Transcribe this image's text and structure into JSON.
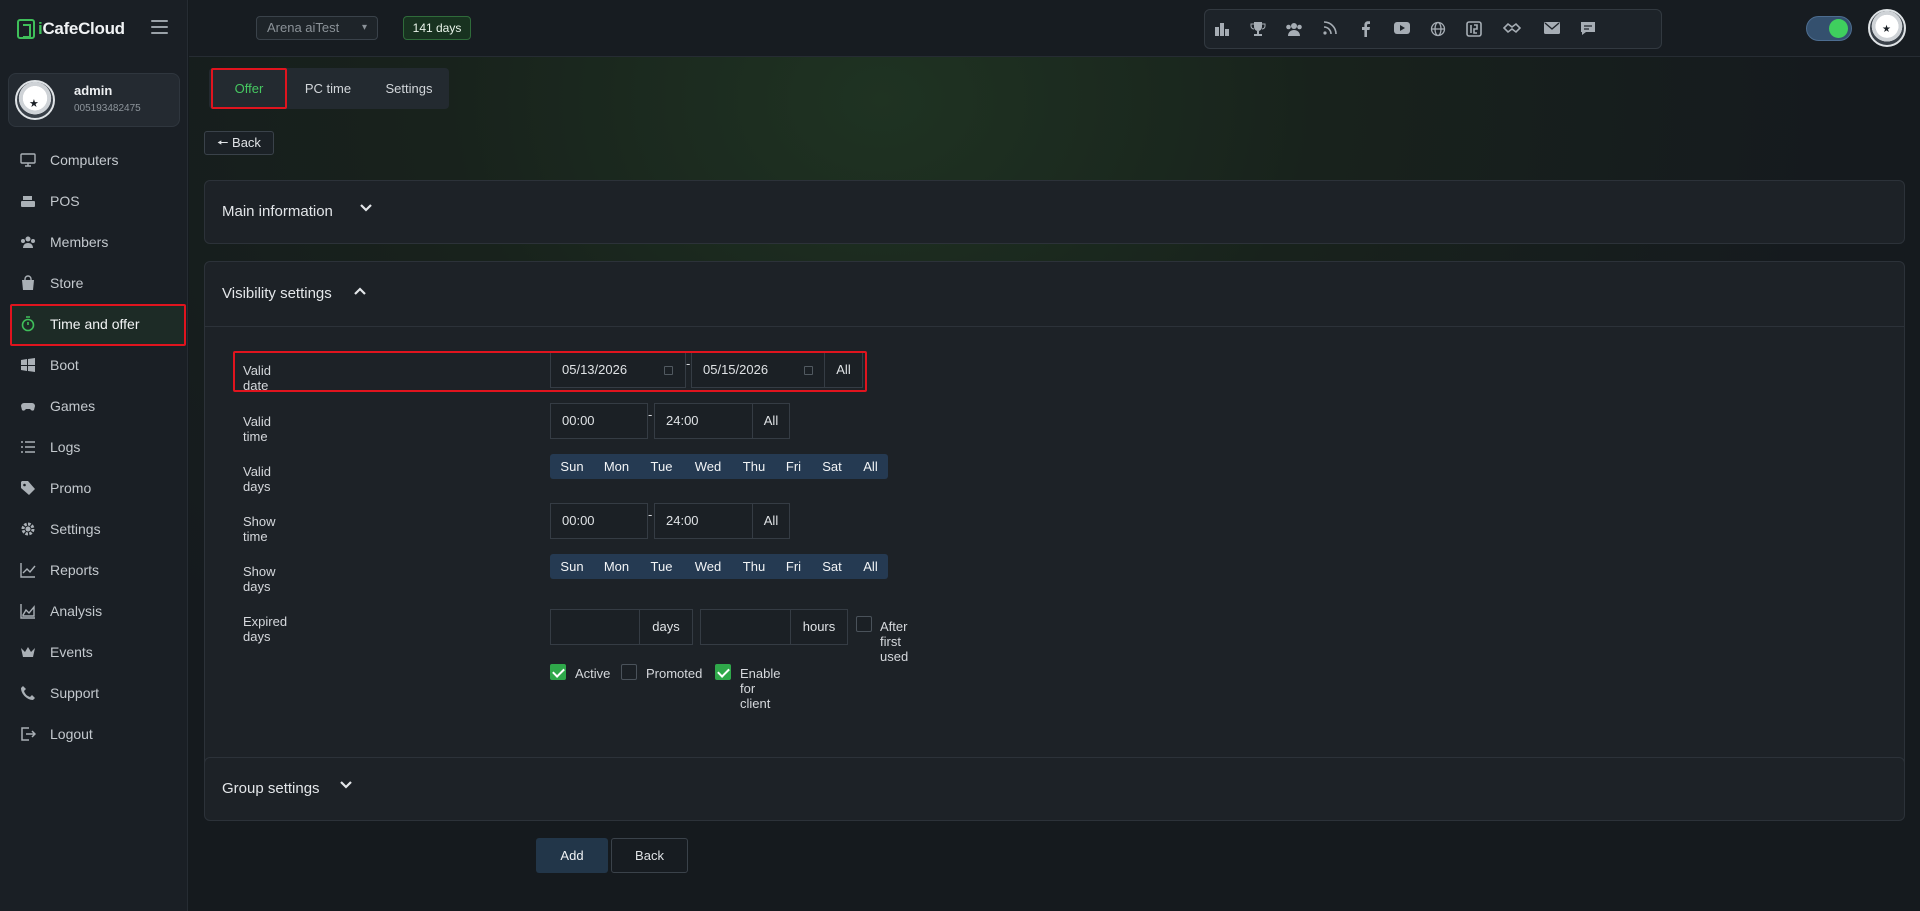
{
  "app": {
    "brand_prefix": "i",
    "brand_name": "CafeCloud"
  },
  "user": {
    "name": "admin",
    "id": "005193482475"
  },
  "sidebar": {
    "items": [
      {
        "label": "Computers",
        "icon": "monitor-icon"
      },
      {
        "label": "POS",
        "icon": "cash-register-icon"
      },
      {
        "label": "Members",
        "icon": "users-icon"
      },
      {
        "label": "Store",
        "icon": "shopping-bag-icon"
      },
      {
        "label": "Time and offer",
        "icon": "stopwatch-icon",
        "active": true
      },
      {
        "label": "Boot",
        "icon": "windows-icon"
      },
      {
        "label": "Games",
        "icon": "gamepad-icon"
      },
      {
        "label": "Logs",
        "icon": "list-icon"
      },
      {
        "label": "Promo",
        "icon": "tag-icon"
      },
      {
        "label": "Settings",
        "icon": "gear-icon"
      },
      {
        "label": "Reports",
        "icon": "line-chart-icon"
      },
      {
        "label": "Analysis",
        "icon": "area-chart-icon"
      },
      {
        "label": "Events",
        "icon": "crown-icon"
      },
      {
        "label": "Support",
        "icon": "phone-icon"
      },
      {
        "label": "Logout",
        "icon": "logout-icon"
      }
    ]
  },
  "topbar": {
    "arena": "Arena aiTest",
    "days_badge": "141 days",
    "social_icons": [
      "leaderboard-icon",
      "trophy-icon",
      "group-icon",
      "rss-icon",
      "facebook-icon",
      "youtube-icon",
      "globe-icon",
      "icafe-icon",
      "handshake-icon",
      "mail-icon",
      "chat-icon"
    ],
    "theme_toggle_on": true
  },
  "tabs": {
    "offer": "Offer",
    "pc_time": "PC time",
    "settings": "Settings",
    "active": "Offer"
  },
  "back_top": "🠔 Back",
  "panels": {
    "main_information": "Main information",
    "visibility_settings": "Visibility settings",
    "group_settings": "Group settings"
  },
  "visibility": {
    "valid_date": {
      "label": "Valid date",
      "from": "05/13/2026",
      "to": "05/15/2026",
      "all": "All"
    },
    "valid_time": {
      "label": "Valid time",
      "from": "00:00",
      "to": "24:00",
      "all": "All"
    },
    "valid_days": {
      "label": "Valid days"
    },
    "show_time": {
      "label": "Show time",
      "from": "00:00",
      "to": "24:00",
      "all": "All"
    },
    "show_days": {
      "label": "Show days"
    },
    "days": [
      "Sun",
      "Mon",
      "Tue",
      "Wed",
      "Thu",
      "Fri",
      "Sat",
      "All"
    ],
    "expired_days": {
      "label": "Expired days",
      "days_value": "",
      "days_unit": "days",
      "hours_value": "",
      "hours_unit": "hours",
      "after_first_used": "After first used",
      "after_first_used_checked": false
    },
    "flags": {
      "active": {
        "label": "Active",
        "checked": true
      },
      "promoted": {
        "label": "Promoted",
        "checked": false
      },
      "enable_for_client": {
        "label": "Enable for client",
        "checked": true
      }
    },
    "dash": "-"
  },
  "actions": {
    "add": "Add",
    "back": "Back"
  },
  "colors": {
    "accent_green": "#3fbf5a",
    "highlight_red": "#e0141e",
    "day_button_blue": "#253a52"
  }
}
